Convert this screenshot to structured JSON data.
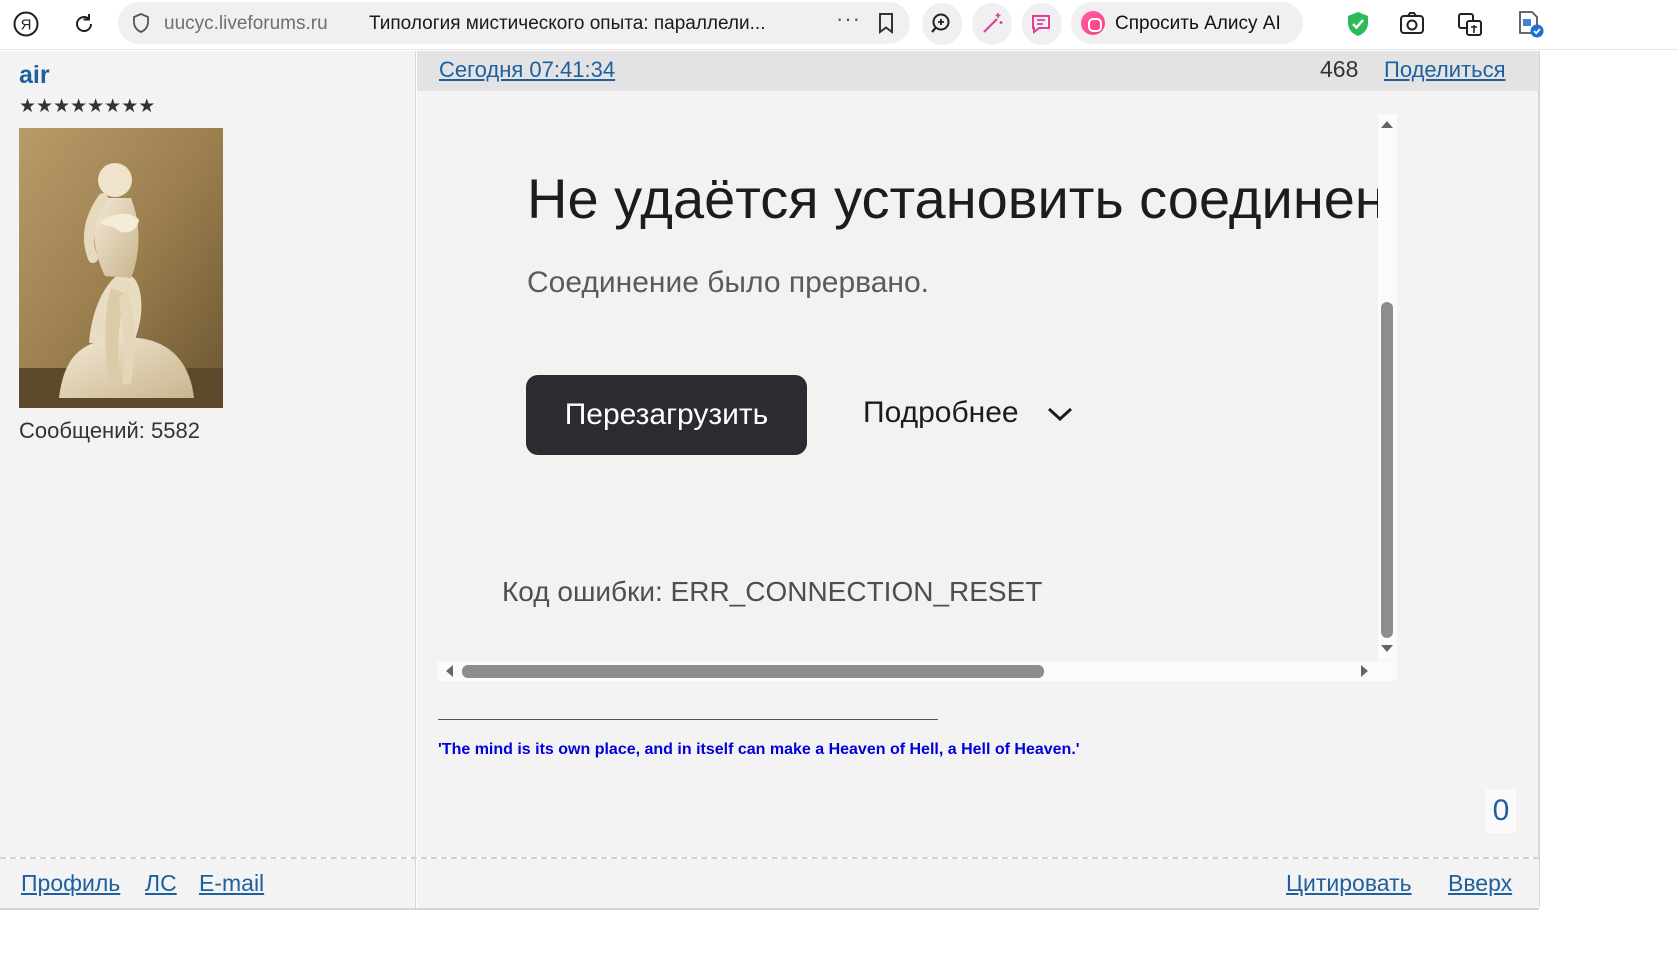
{
  "browser": {
    "domain": "uucyc.liveforums.ru",
    "tab_title": "Типология мистического опыта: параллели...",
    "more_label": "···",
    "alice_label": "Спросить Алису AI"
  },
  "profile": {
    "username": "air",
    "stars": "★★★★★★★★",
    "posts_label": "Сообщений:",
    "posts_count": "5582"
  },
  "post": {
    "date": "Сегодня 07:41:34",
    "number": "468",
    "share": "Поделиться",
    "vote": "0"
  },
  "error_frame": {
    "title": "Не удаётся установить соединение",
    "subtitle": "Соединение было прервано.",
    "reload_button": "Перезагрузить",
    "details_button": "Подробнее",
    "error_code": "Код ошибки: ERR_CONNECTION_RESET"
  },
  "signature": "'The mind is its own place, and in itself can make a Heaven of Hell, a Hell of Heaven.'",
  "footer": {
    "profile": "Профиль",
    "pm": "ЛС",
    "email": "E-mail",
    "quote": "Цитировать",
    "top": "Вверх"
  },
  "colors": {
    "link": "#1f5f9f",
    "signature": "#0000dd",
    "reload_bg": "#2b2b30"
  }
}
